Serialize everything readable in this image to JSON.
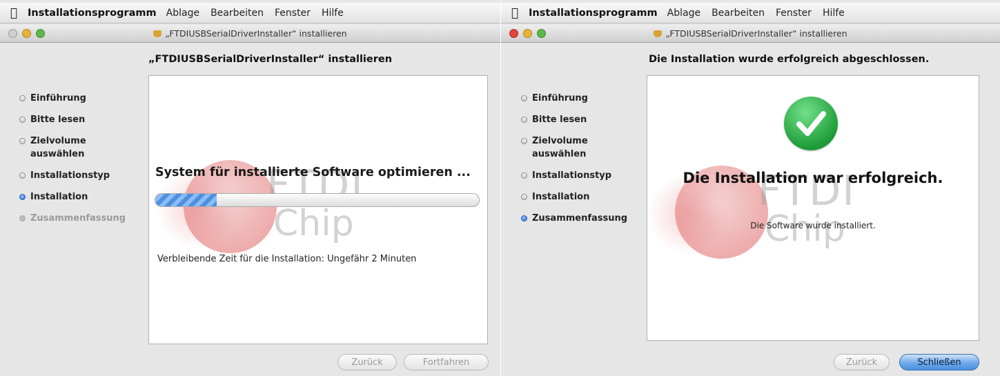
{
  "colors": {
    "accent": "#4a8fe0",
    "success": "#1e9d3a",
    "close": "#e0443a",
    "minimize": "#e8b33a",
    "zoom": "#5cb84a"
  },
  "left": {
    "menubar": {
      "app_name": "Installationsprogramm",
      "items": [
        "Ablage",
        "Bearbeiten",
        "Fenster",
        "Hilfe"
      ]
    },
    "window_title": "„FTDIUSBSerialDriverInstaller“ installieren",
    "heading": "„FTDIUSBSerialDriverInstaller“ installieren",
    "steps": [
      "Einführung",
      "Bitte lesen",
      "Zielvolume auswählen",
      "Installationstyp",
      "Installation",
      "Zusammenfassung"
    ],
    "current_step": "Installation",
    "status_text": "System für installierte Software optimieren ...",
    "progress_percent": 19,
    "remaining_text": "Verbleibende Zeit für die Installation: Ungefähr 2 Minuten",
    "logo": {
      "line1": "FTDI",
      "line2": "Chip"
    },
    "buttons": {
      "back": "Zurück",
      "continue": "Fortfahren"
    }
  },
  "right": {
    "menubar": {
      "app_name": "Installationsprogramm",
      "items": [
        "Ablage",
        "Bearbeiten",
        "Fenster",
        "Hilfe"
      ]
    },
    "window_title": "„FTDIUSBSerialDriverInstaller“ installieren",
    "heading": "Die Installation wurde erfolgreich abgeschlossen.",
    "steps": [
      "Einführung",
      "Bitte lesen",
      "Zielvolume auswählen",
      "Installationstyp",
      "Installation",
      "Zusammenfassung"
    ],
    "current_step": "Zusammenfassung",
    "success_title": "Die Installation war erfolgreich.",
    "success_message": "Die Software wurde installiert.",
    "logo": {
      "line1": "FTDI",
      "line2": "Chip"
    },
    "buttons": {
      "back": "Zurück",
      "close": "Schließen"
    }
  }
}
